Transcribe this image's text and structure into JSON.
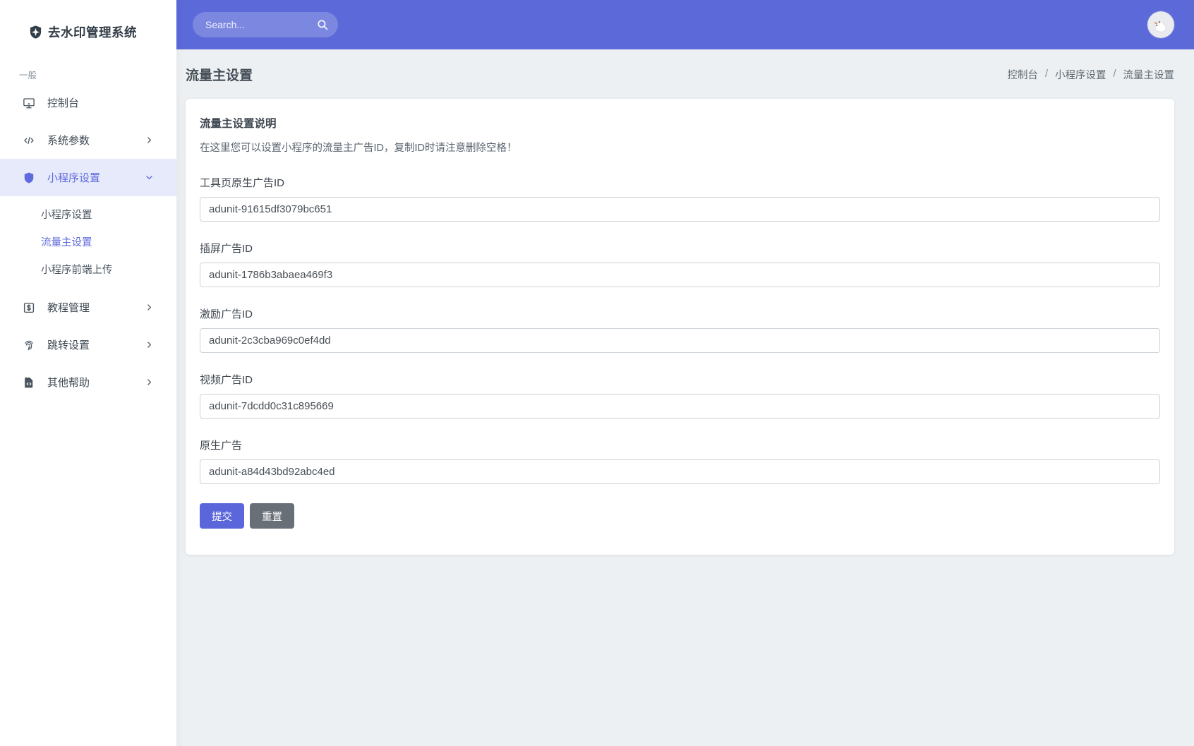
{
  "app": {
    "title": "去水印管理系统"
  },
  "topbar": {
    "search_placeholder": "Search..."
  },
  "sidebar": {
    "section_label": "一般",
    "items": [
      {
        "label": "控制台",
        "icon": "desktop-icon"
      },
      {
        "label": "系统参数",
        "icon": "code-icon",
        "chevron": "right"
      },
      {
        "label": "小程序设置",
        "icon": "shield-icon",
        "chevron": "down",
        "active": true
      },
      {
        "label": "教程管理",
        "icon": "dollar-square-icon",
        "chevron": "right"
      },
      {
        "label": "跳转设置",
        "icon": "fingerprint-icon",
        "chevron": "right"
      },
      {
        "label": "其他帮助",
        "icon": "file-code-icon",
        "chevron": "right"
      }
    ],
    "submenu": [
      {
        "label": "小程序设置",
        "active": false
      },
      {
        "label": "流量主设置",
        "active": true
      },
      {
        "label": "小程序前端上传",
        "active": false
      }
    ]
  },
  "page": {
    "title": "流量主设置",
    "breadcrumb": [
      "控制台",
      "小程序设置",
      "流量主设置"
    ],
    "breadcrumb_separator": "/"
  },
  "form": {
    "heading": "流量主设置说明",
    "description": "在这里您可以设置小程序的流量主广告ID，复制ID时请注意删除空格！",
    "fields": [
      {
        "label": "工具页原生广告ID",
        "value": "adunit-91615df3079bc651"
      },
      {
        "label": "插屏广告ID",
        "value": "adunit-1786b3abaea469f3"
      },
      {
        "label": "激励广告ID",
        "value": "adunit-2c3cba969c0ef4dd"
      },
      {
        "label": "视频广告ID",
        "value": "adunit-7dcdd0c31c895669"
      },
      {
        "label": "原生广告",
        "value": "adunit-a84d43bd92abc4ed"
      }
    ],
    "submit_label": "提交",
    "reset_label": "重置"
  },
  "colors": {
    "topbar": "#5c69d9",
    "accent": "#5f6bdc",
    "active_item_bg": "#e7eafb",
    "content_bg": "#edf0f2",
    "submit_button": "#5a66d9",
    "reset_button": "#686f77"
  }
}
